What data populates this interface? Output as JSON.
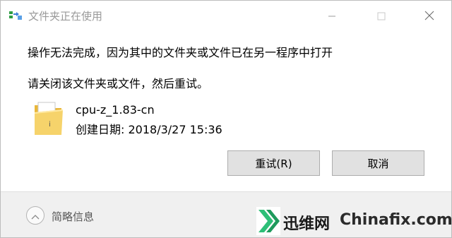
{
  "window": {
    "title": "文件夹正在使用"
  },
  "message": {
    "line1": "操作无法完成，因为其中的文件夹或文件已在另一程序中打开",
    "line2": "请关闭该文件夹或文件，然后重试。"
  },
  "file": {
    "name": "cpu-z_1.83-cn",
    "date": "创建日期: 2018/3/27 15:36"
  },
  "buttons": {
    "retry": "重试(R)",
    "cancel": "取消"
  },
  "footer": {
    "details": "简略信息"
  },
  "watermark": {
    "brand_cn": "迅维网",
    "brand_en": "Chinafix.com"
  },
  "colors": {
    "title_text": "#9a9a9a",
    "button_bg": "#e1e1e1",
    "footer_bg": "#f0f0f0",
    "folder": "#f2c94c",
    "watermark_green": "#2dbf77"
  },
  "icons": {
    "title": "folder-in-use-icon",
    "file": "folder-with-document-icon",
    "minimize": "minimize-icon",
    "maximize": "maximize-icon",
    "close": "close-icon",
    "details_toggle": "chevron-up-icon"
  }
}
